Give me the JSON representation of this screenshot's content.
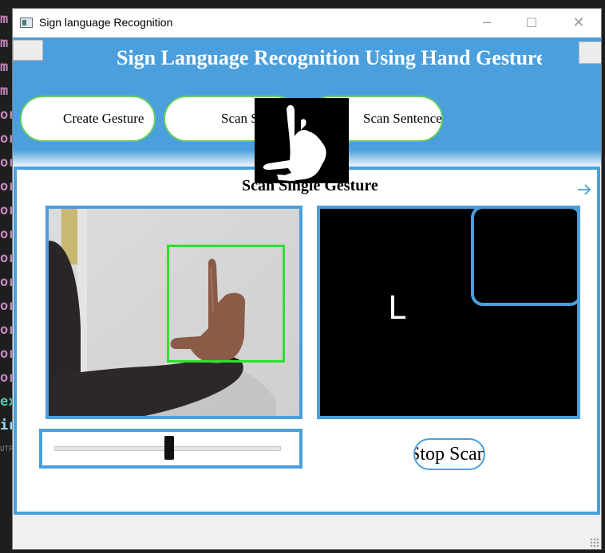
{
  "window": {
    "title": "Sign language Recognition",
    "controls": {
      "minimize": "─",
      "maximize": "☐",
      "close": "✕"
    }
  },
  "header": {
    "heading": "Sign Language Recognition Using Hand Gestures",
    "buttons": [
      {
        "label": "Create Gesture"
      },
      {
        "label": "Scan Single Gesture"
      },
      {
        "label": "Scan Sentence"
      }
    ],
    "accent_color": "#4a9fdc",
    "button_border_color": "#67d060"
  },
  "main": {
    "section_title": "Scan Single Gesture",
    "arrow_icon": "arrow-right-icon",
    "prediction": "L",
    "stop_button": "Stop Scan",
    "slider_value": 0.51,
    "roi_color": "#2ee02e"
  },
  "background_editor": {
    "fragments": [
      "m",
      "m",
      "m",
      "m",
      "or",
      "or",
      "or",
      "or",
      "or",
      "or",
      "or",
      "or",
      "or",
      "or",
      "or",
      "or",
      "ex",
      "ir",
      "UTP"
    ]
  }
}
